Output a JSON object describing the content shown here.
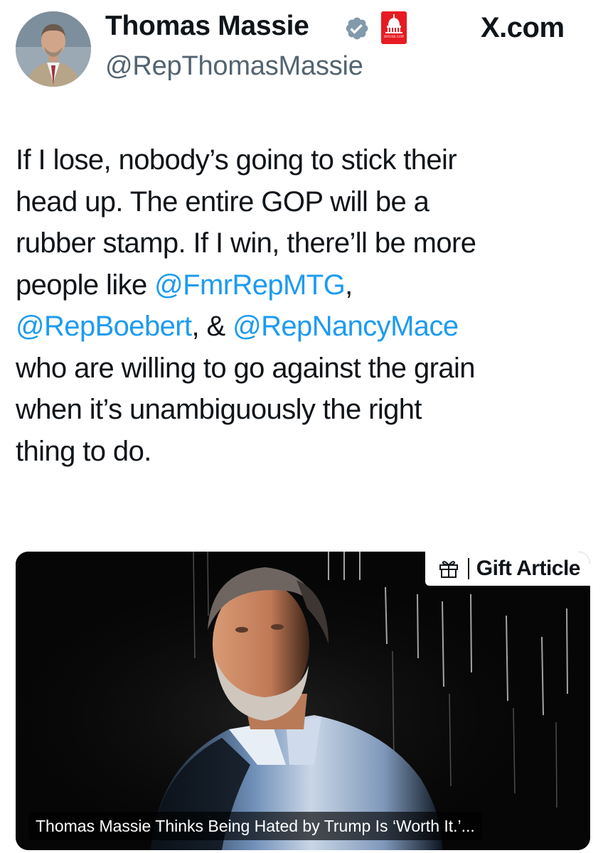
{
  "author": {
    "name": "Thomas Massie",
    "handle": "@RepThomasMassie",
    "verified_icon": "verified-badge-icon",
    "affiliation_icon": "house-gop-capitol-badge",
    "affiliation_badge_text": "HOUSE GOP"
  },
  "site": {
    "label": "X.com"
  },
  "tweet": {
    "lines": [
      {
        "text": "If I lose, nobody’s going to stick their"
      },
      {
        "text": "head up. The entire GOP will be a"
      },
      {
        "text": "rubber stamp. If I win, there’ll be more"
      },
      {
        "text": "people like ",
        "mention": "@FmrRepMTG",
        "after": ","
      },
      {
        "mention": "@RepBoebert",
        "text": ", & ",
        "mention2": "@RepNancyMace"
      },
      {
        "text": "who are willing to go against the grain"
      },
      {
        "text": "when it’s unambiguously the right"
      },
      {
        "text": "thing to do."
      }
    ]
  },
  "media": {
    "gift_label": "Gift Article",
    "gift_icon": "gift-icon",
    "caption": "Thomas Massie Thinks Being Hated by Trump Is ‘Worth It.’..."
  },
  "colors": {
    "text": "#0f1419",
    "secondary": "#536471",
    "mention": "#1d9bf0",
    "badge_red": "#e61b23",
    "verified_gray": "#829aab"
  }
}
